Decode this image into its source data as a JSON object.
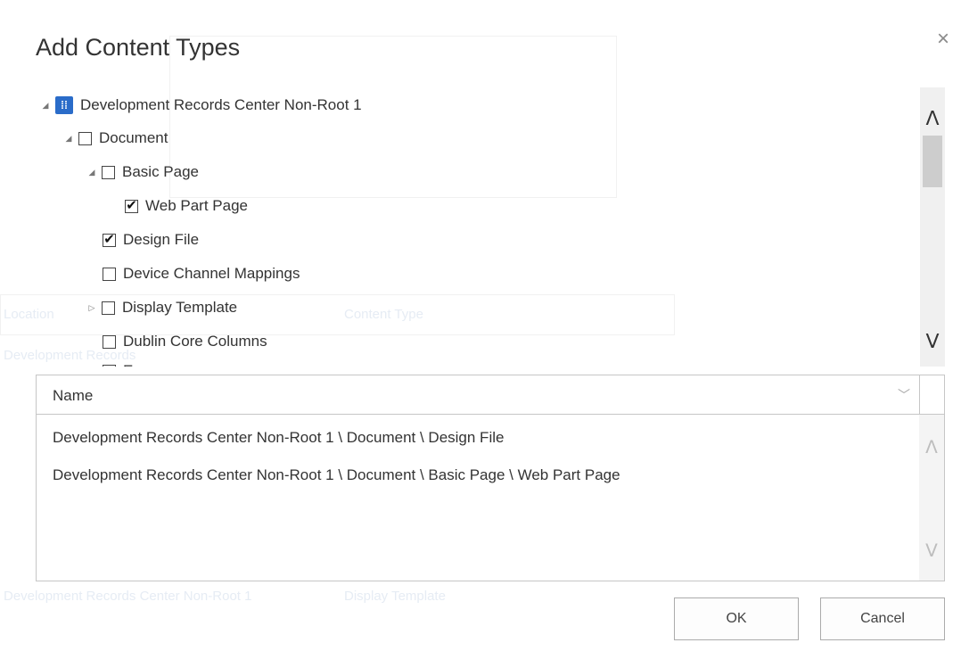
{
  "dialog": {
    "title": "Add Content Types",
    "close_glyph": "×"
  },
  "tree": {
    "site": {
      "label": "Development Records Center Non-Root 1",
      "icon": "site-icon",
      "expanded": true
    },
    "items": [
      {
        "label": "Document",
        "checked": false,
        "expanded": true,
        "level": 1
      },
      {
        "label": "Basic Page",
        "checked": false,
        "expanded": true,
        "level": 2
      },
      {
        "label": "Web Part Page",
        "checked": true,
        "level": 3
      },
      {
        "label": "Design File",
        "checked": true,
        "level": 2
      },
      {
        "label": "Device Channel Mappings",
        "checked": false,
        "level": 2
      },
      {
        "label": "Display Template",
        "checked": false,
        "expanded": false,
        "level": 2
      },
      {
        "label": "Dublin Core Columns",
        "checked": false,
        "level": 2
      },
      {
        "label": "E",
        "checked": false,
        "level": 2
      }
    ],
    "scroll_up_glyph": "ᐱ",
    "scroll_down_glyph": "ᐯ"
  },
  "selected_list": {
    "header": "Name",
    "header_chevron": "﹀",
    "items": [
      "Development Records Center Non-Root 1 \\ Document \\ Design File",
      "Development Records Center Non-Root 1 \\ Document \\ Basic Page \\ Web Part Page"
    ]
  },
  "buttons": {
    "ok": "OK",
    "cancel": "Cancel"
  },
  "background_page": {
    "col_location": "Location",
    "col_content_type": "Content Type",
    "row_1": "Development Records",
    "row_2": "Development Records Center Non-Root 1",
    "row_2_type": "Display Template"
  },
  "colors": {
    "site_icon": "#2a6cc9",
    "title": "#333333",
    "border": "#c6c6c6"
  }
}
